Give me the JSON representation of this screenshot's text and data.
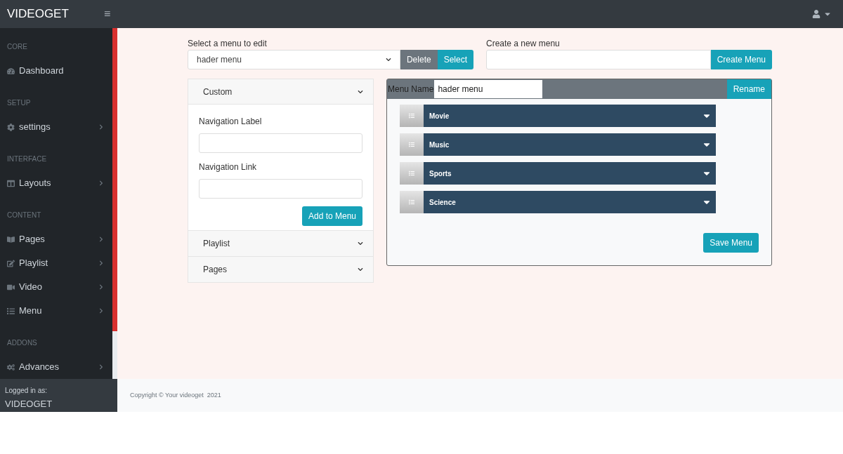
{
  "topbar": {
    "brand": "VIDEOGET",
    "menu_icon": "≡"
  },
  "sidebar": {
    "sections": [
      {
        "heading": "CORE",
        "items": [
          {
            "label": "Dashboard",
            "has_submenu": false
          }
        ]
      },
      {
        "heading": "SETUP",
        "items": [
          {
            "label": "settings",
            "has_submenu": true
          }
        ]
      },
      {
        "heading": "INTERFACE",
        "items": [
          {
            "label": "Layouts",
            "has_submenu": true
          }
        ]
      },
      {
        "heading": "CONTENT",
        "items": [
          {
            "label": "Pages",
            "has_submenu": true
          },
          {
            "label": "Playlist",
            "has_submenu": true
          },
          {
            "label": "Video",
            "has_submenu": true
          },
          {
            "label": "Menu",
            "has_submenu": true
          }
        ]
      },
      {
        "heading": "ADDONS",
        "items": [
          {
            "label": "Advances",
            "has_submenu": true
          }
        ]
      }
    ],
    "footer": {
      "caption": "Logged in as:",
      "user": "VIDEOGET"
    }
  },
  "select_menu": {
    "label": "Select a menu to edit",
    "value": "hader menu",
    "buttons": [
      "Delete",
      "Select"
    ]
  },
  "create_menu": {
    "label": "Create a new menu",
    "button": "Create Menu"
  },
  "accordion": [
    {
      "title": "Custom",
      "expanded": true,
      "fields": [
        "Navigation Label",
        "Navigation Link"
      ],
      "button": "Add to Menu"
    },
    {
      "title": "Playlist",
      "expanded": false
    },
    {
      "title": "Pages",
      "expanded": false
    }
  ],
  "menu_editor": {
    "name_label": "Menu Name",
    "name_value": "hader menu",
    "rename_button": "Rename",
    "items": [
      {
        "label": "Movie"
      },
      {
        "label": "Music"
      },
      {
        "label": "Sports"
      },
      {
        "label": "Science"
      }
    ],
    "save_button": "Save Menu"
  },
  "footer": {
    "copyright": "Copyright © Your videoget  2021"
  }
}
